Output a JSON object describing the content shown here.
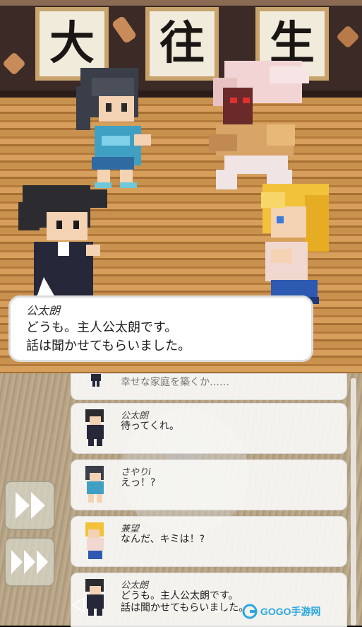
{
  "scene": {
    "wall_scrolls": [
      "大",
      "往",
      "生"
    ]
  },
  "dialog": {
    "speaker": "公太朗",
    "lines": [
      "どうも。主人公太朗です。",
      "話は聞かせてもらいました。"
    ]
  },
  "log": {
    "partial_top_text": "幸せな家庭を築くか……",
    "entries": [
      {
        "name": "公太朗",
        "lines": [
          "待ってくれ。"
        ]
      },
      {
        "name": "さやりi",
        "lines": [
          "えっ！?"
        ]
      },
      {
        "name": "兼望",
        "lines": [
          "なんだ、キミは！?"
        ]
      },
      {
        "name": "公太朗",
        "lines": [
          "どうも。主人公太朗です。",
          "話は聞かせてもらいました。"
        ]
      }
    ]
  },
  "controls": {
    "fast_forward_icon": "fast-forward-icon",
    "skip_icon": "skip-icon"
  },
  "nav": {
    "back_icon": "back-triangle-icon",
    "home_icon": "home-circle-icon",
    "recent_icon": "recent-square-icon"
  },
  "watermark": {
    "text": "GOGO手游网"
  },
  "colors": {
    "wall": "#3b2a26",
    "floor": "#c9914e",
    "dialog_bg": "#ffffff",
    "log_bg": "#f8f8f6"
  }
}
